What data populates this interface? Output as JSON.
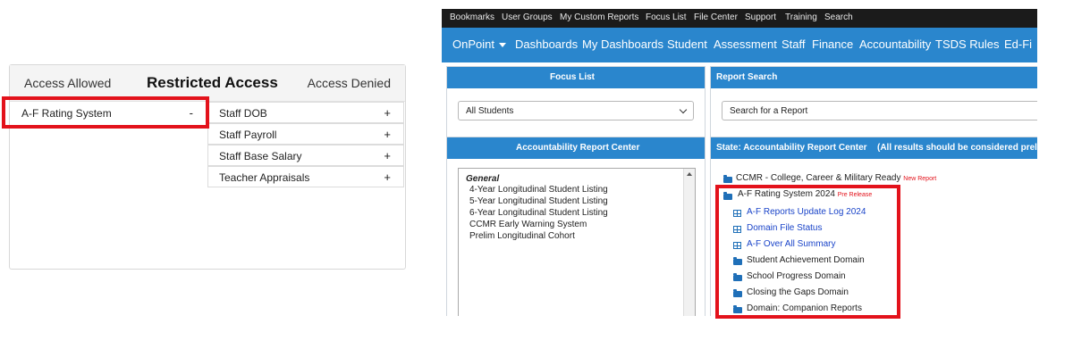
{
  "access": {
    "allowed_label": "Access Allowed",
    "restricted_label": "Restricted Access",
    "denied_label": "Access Denied",
    "restricted_items": [
      {
        "label": "A-F Rating System",
        "sign": "-"
      }
    ],
    "denied_items": [
      {
        "label": "Staff DOB",
        "sign": "+"
      },
      {
        "label": "Staff Payroll",
        "sign": "+"
      },
      {
        "label": "Staff Base Salary",
        "sign": "+"
      },
      {
        "label": "Teacher Appraisals",
        "sign": "+"
      }
    ]
  },
  "onpoint": {
    "top_links": [
      "Bookmarks",
      "User Groups",
      "My Custom Reports",
      "Focus List",
      "File Center",
      "Support",
      "Training",
      "Search"
    ],
    "nav": {
      "brand": "OnPoint",
      "items": [
        "Dashboards",
        "My Dashboards",
        "Student",
        "Assessment",
        "Staff",
        "Finance",
        "Accountability",
        "TSDS Rules",
        "Ed-Fi"
      ]
    },
    "focus_list": {
      "title": "Focus List",
      "selected": "All Students"
    },
    "report_search": {
      "title": "Report Search",
      "selected": "Search for a Report"
    },
    "arc": {
      "title": "Accountability Report Center",
      "group_label": "General",
      "items": [
        "4-Year Longitudinal Student Listing",
        "5-Year Longitudinal Student Listing",
        "6-Year Longitudinal Student Listing",
        "CCMR Early Warning System",
        "Prelim Longitudinal Cohort"
      ]
    },
    "state_arc": {
      "title": "State: Accountability Report Center",
      "note": "(All results should be considered prelim",
      "ccmr": {
        "label": "CCMR - College, Career & Military Ready",
        "tag": "New Report"
      },
      "af": {
        "label": "A-F Rating System 2024",
        "tag": "Pre Release"
      },
      "children": [
        {
          "label": "A-F Reports Update Log 2024",
          "icon": "table-icon",
          "link": true
        },
        {
          "label": "Domain File Status",
          "icon": "table-icon",
          "link": true
        },
        {
          "label": "A-F Over All Summary",
          "icon": "table-icon",
          "link": true
        },
        {
          "label": "Student Achievement Domain",
          "icon": "folder-icon",
          "link": false
        },
        {
          "label": "School Progress Domain",
          "icon": "folder-icon",
          "link": false
        },
        {
          "label": "Closing the Gaps Domain",
          "icon": "folder-icon",
          "link": false
        },
        {
          "label": "Domain: Companion Reports",
          "icon": "folder-icon",
          "link": false
        }
      ]
    }
  },
  "colors": {
    "highlight": "#e3121b",
    "nav_blue": "#2a86cd",
    "link_blue": "#1a44c9"
  }
}
